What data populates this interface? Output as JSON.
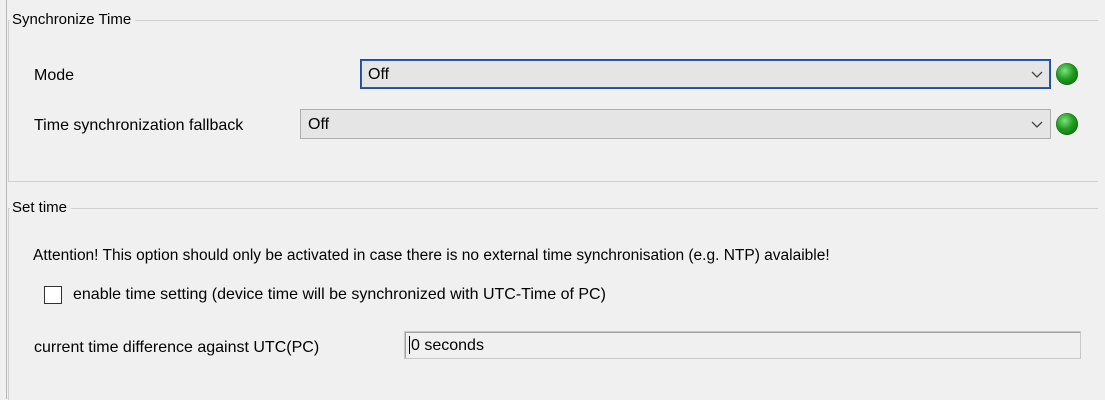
{
  "sync_group": {
    "title": "Synchronize Time",
    "mode": {
      "label": "Mode",
      "value": "Off",
      "status_color": "#1f9b1f",
      "status_icon": "green-led-icon"
    },
    "fallback": {
      "label": "Time synchronization fallback",
      "value": "Off",
      "status_color": "#1f9b1f",
      "status_icon": "green-led-icon"
    }
  },
  "set_time_group": {
    "title": "Set time",
    "attention_text": "Attention! This option should only be activated in case there is no external time synchronisation (e.g. NTP) avalaible!",
    "enable_checkbox": {
      "label": "enable time setting (device time will be synchronized with UTC-Time of PC)",
      "checked": false
    },
    "time_difference": {
      "label": "current time difference against UTC(PC)",
      "value": "0 seconds"
    }
  }
}
